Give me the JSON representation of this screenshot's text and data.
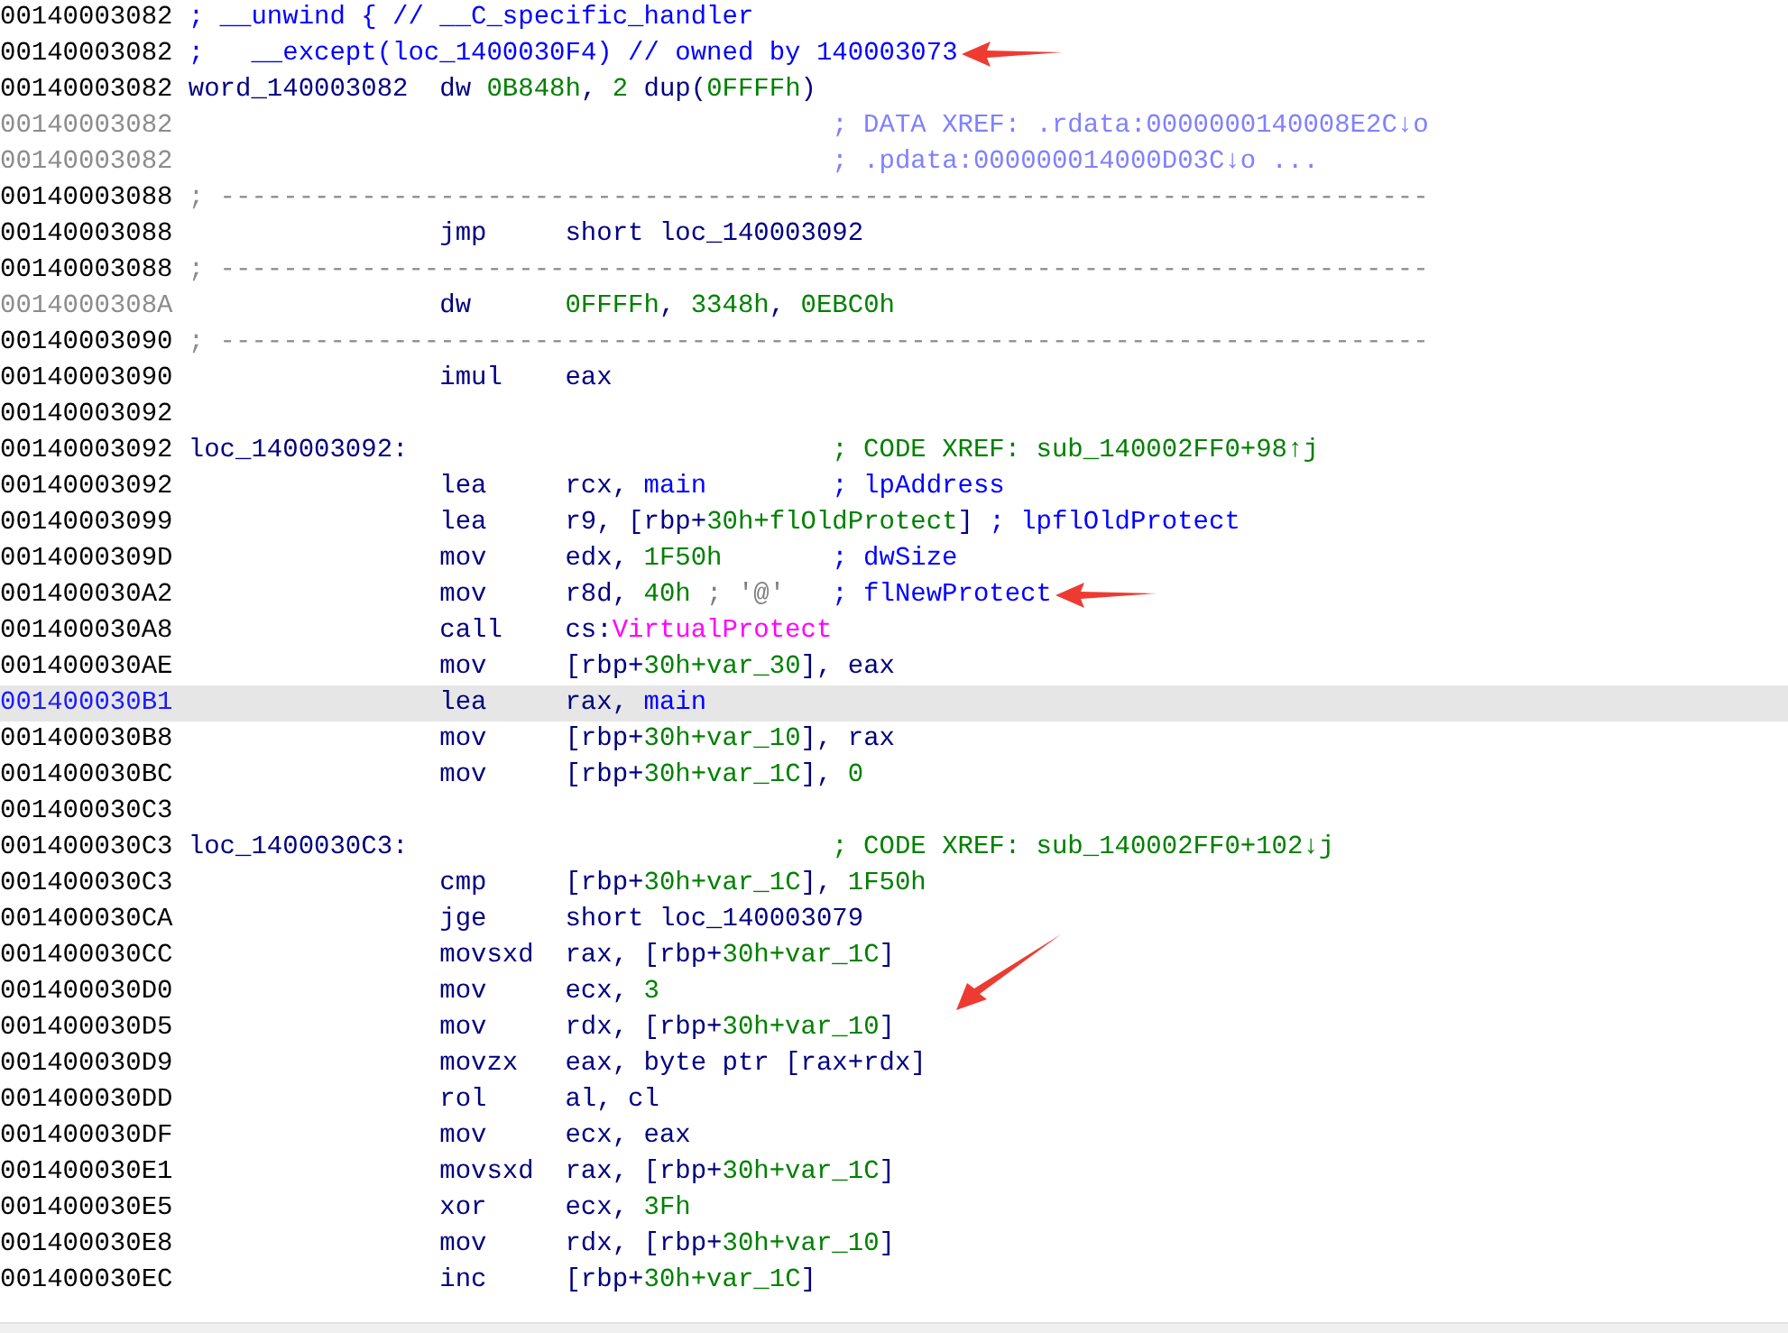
{
  "listing": [
    {
      "address": "00140003082",
      "dim": false,
      "selected": false,
      "kind": "note",
      "text": "; __unwind { // __C_specific_handler"
    },
    {
      "address": "00140003082",
      "dim": false,
      "selected": false,
      "kind": "note",
      "text": ";   __except(loc_1400030F4) // owned by 140003073",
      "arrow": {
        "kind": "left"
      }
    },
    {
      "address": "00140003082",
      "dim": false,
      "selected": false,
      "kind": "data",
      "label": "word_140003082",
      "ops": [
        {
          "t": "dw ",
          "kind": "reg"
        },
        {
          "t": "0B848h",
          "kind": "num"
        },
        {
          "t": ", ",
          "kind": "reg"
        },
        {
          "t": "2",
          "kind": "num"
        },
        {
          "t": " dup(",
          "kind": "reg"
        },
        {
          "t": "0FFFFh",
          "kind": "num"
        },
        {
          "t": ")",
          "kind": "reg"
        }
      ]
    },
    {
      "address": "00140003082",
      "dim": true,
      "selected": false,
      "kind": "xref",
      "comment": "; DATA XREF: .rdata:0000000140008E2C↓o"
    },
    {
      "address": "00140003082",
      "dim": true,
      "selected": false,
      "kind": "xref",
      "comment": "; .pdata:000000014000D03C↓o ..."
    },
    {
      "address": "00140003088",
      "dim": false,
      "selected": false,
      "kind": "sep",
      "text": "; -----------------------------------------------------------------------------"
    },
    {
      "address": "00140003088",
      "dim": false,
      "selected": false,
      "kind": "code",
      "mnemonic": "jmp",
      "ops": [
        {
          "t": "short loc_140003092",
          "kind": "reg"
        }
      ]
    },
    {
      "address": "00140003088",
      "dim": false,
      "selected": false,
      "kind": "sep",
      "text": "; -----------------------------------------------------------------------------"
    },
    {
      "address": "0014000308A",
      "dim": true,
      "selected": false,
      "kind": "code",
      "mnemonic": "dw",
      "ops": [
        {
          "t": "0FFFFh",
          "kind": "num"
        },
        {
          "t": ", ",
          "kind": "reg"
        },
        {
          "t": "3348h",
          "kind": "num"
        },
        {
          "t": ", ",
          "kind": "reg"
        },
        {
          "t": "0EBC0h",
          "kind": "num"
        }
      ]
    },
    {
      "address": "00140003090",
      "dim": false,
      "selected": false,
      "kind": "sep",
      "text": "; -----------------------------------------------------------------------------"
    },
    {
      "address": "00140003090",
      "dim": false,
      "selected": false,
      "kind": "code",
      "mnemonic": "imul",
      "ops": [
        {
          "t": "eax",
          "kind": "reg"
        }
      ]
    },
    {
      "address": "00140003092",
      "dim": false,
      "selected": false,
      "kind": "blank"
    },
    {
      "address": "00140003092",
      "dim": false,
      "selected": false,
      "kind": "label",
      "label": "loc_140003092:",
      "comment": "; CODE XREF: sub_140002FF0+98↑j"
    },
    {
      "address": "00140003092",
      "dim": false,
      "selected": false,
      "kind": "code",
      "mnemonic": "lea",
      "ops": [
        {
          "t": "rcx, ",
          "kind": "reg"
        },
        {
          "t": "main",
          "kind": "name"
        }
      ],
      "comment": "; lpAddress"
    },
    {
      "address": "00140003099",
      "dim": false,
      "selected": false,
      "kind": "code",
      "mnemonic": "lea",
      "ops": [
        {
          "t": "r9, [rbp+",
          "kind": "reg"
        },
        {
          "t": "30h+flOldProtect",
          "kind": "num"
        },
        {
          "t": "]",
          "kind": "reg"
        }
      ],
      "comment": "; lpflOldProtect"
    },
    {
      "address": "0014000309D",
      "dim": false,
      "selected": false,
      "kind": "code",
      "mnemonic": "mov",
      "ops": [
        {
          "t": "edx, ",
          "kind": "reg"
        },
        {
          "t": "1F50h",
          "kind": "num"
        }
      ],
      "comment": "; dwSize"
    },
    {
      "address": "001400030A2",
      "dim": false,
      "selected": false,
      "kind": "code",
      "mnemonic": "mov",
      "ops": [
        {
          "t": "r8d, ",
          "kind": "reg"
        },
        {
          "t": "40h",
          "kind": "num"
        },
        {
          "t": " ; '@'",
          "kind": "cmt"
        }
      ],
      "comment": "; flNewProtect",
      "arrow": {
        "kind": "left"
      }
    },
    {
      "address": "001400030A8",
      "dim": false,
      "selected": false,
      "kind": "code",
      "mnemonic": "call",
      "ops": [
        {
          "t": "cs:",
          "kind": "reg"
        },
        {
          "t": "VirtualProtect",
          "kind": "import"
        }
      ]
    },
    {
      "address": "001400030AE",
      "dim": false,
      "selected": false,
      "kind": "code",
      "mnemonic": "mov",
      "ops": [
        {
          "t": "[rbp+",
          "kind": "reg"
        },
        {
          "t": "30h+var_30",
          "kind": "num"
        },
        {
          "t": "], eax",
          "kind": "reg"
        }
      ]
    },
    {
      "address": "001400030B1",
      "dim": false,
      "selected": true,
      "kind": "code",
      "mnemonic": "lea",
      "ops": [
        {
          "t": "rax, ",
          "kind": "reg"
        },
        {
          "t": "main",
          "kind": "name"
        }
      ]
    },
    {
      "address": "001400030B8",
      "dim": false,
      "selected": false,
      "kind": "code",
      "mnemonic": "mov",
      "ops": [
        {
          "t": "[rbp+",
          "kind": "reg"
        },
        {
          "t": "30h+var_10",
          "kind": "num"
        },
        {
          "t": "], rax",
          "kind": "reg"
        }
      ]
    },
    {
      "address": "001400030BC",
      "dim": false,
      "selected": false,
      "kind": "code",
      "mnemonic": "mov",
      "ops": [
        {
          "t": "[rbp+",
          "kind": "reg"
        },
        {
          "t": "30h+var_1C",
          "kind": "num"
        },
        {
          "t": "], ",
          "kind": "reg"
        },
        {
          "t": "0",
          "kind": "num"
        }
      ]
    },
    {
      "address": "001400030C3",
      "dim": false,
      "selected": false,
      "kind": "blank"
    },
    {
      "address": "001400030C3",
      "dim": false,
      "selected": false,
      "kind": "label",
      "label": "loc_1400030C3:",
      "comment": "; CODE XREF: sub_140002FF0+102↓j"
    },
    {
      "address": "001400030C3",
      "dim": false,
      "selected": false,
      "kind": "code",
      "mnemonic": "cmp",
      "ops": [
        {
          "t": "[rbp+",
          "kind": "reg"
        },
        {
          "t": "30h+var_1C",
          "kind": "num"
        },
        {
          "t": "], ",
          "kind": "reg"
        },
        {
          "t": "1F50h",
          "kind": "num"
        }
      ]
    },
    {
      "address": "001400030CA",
      "dim": false,
      "selected": false,
      "kind": "code",
      "mnemonic": "jge",
      "ops": [
        {
          "t": "short loc_140003079",
          "kind": "reg"
        }
      ]
    },
    {
      "address": "001400030CC",
      "dim": false,
      "selected": false,
      "kind": "code",
      "mnemonic": "movsxd",
      "ops": [
        {
          "t": "rax, [rbp+",
          "kind": "reg"
        },
        {
          "t": "30h+var_1C",
          "kind": "num"
        },
        {
          "t": "]",
          "kind": "reg"
        }
      ]
    },
    {
      "address": "001400030D0",
      "dim": false,
      "selected": false,
      "kind": "code",
      "mnemonic": "mov",
      "ops": [
        {
          "t": "ecx, ",
          "kind": "reg"
        },
        {
          "t": "3",
          "kind": "num"
        }
      ],
      "arrow": {
        "kind": "diagonal"
      }
    },
    {
      "address": "001400030D5",
      "dim": false,
      "selected": false,
      "kind": "code",
      "mnemonic": "mov",
      "ops": [
        {
          "t": "rdx, [rbp+",
          "kind": "reg"
        },
        {
          "t": "30h+var_10",
          "kind": "num"
        },
        {
          "t": "]",
          "kind": "reg"
        }
      ]
    },
    {
      "address": "001400030D9",
      "dim": false,
      "selected": false,
      "kind": "code",
      "mnemonic": "movzx",
      "ops": [
        {
          "t": "eax, byte ptr [rax+rdx]",
          "kind": "reg"
        }
      ]
    },
    {
      "address": "001400030DD",
      "dim": false,
      "selected": false,
      "kind": "code",
      "mnemonic": "rol",
      "ops": [
        {
          "t": "al, cl",
          "kind": "reg"
        }
      ]
    },
    {
      "address": "001400030DF",
      "dim": false,
      "selected": false,
      "kind": "code",
      "mnemonic": "mov",
      "ops": [
        {
          "t": "ecx, eax",
          "kind": "reg"
        }
      ]
    },
    {
      "address": "001400030E1",
      "dim": false,
      "selected": false,
      "kind": "code",
      "mnemonic": "movsxd",
      "ops": [
        {
          "t": "rax, [rbp+",
          "kind": "reg"
        },
        {
          "t": "30h+var_1C",
          "kind": "num"
        },
        {
          "t": "]",
          "kind": "reg"
        }
      ]
    },
    {
      "address": "001400030E5",
      "dim": false,
      "selected": false,
      "kind": "code",
      "mnemonic": "xor",
      "ops": [
        {
          "t": "ecx, ",
          "kind": "reg"
        },
        {
          "t": "3Fh",
          "kind": "num"
        }
      ]
    },
    {
      "address": "001400030E8",
      "dim": false,
      "selected": false,
      "kind": "code",
      "mnemonic": "mov",
      "ops": [
        {
          "t": "rdx, [rbp+",
          "kind": "reg"
        },
        {
          "t": "30h+var_10",
          "kind": "num"
        },
        {
          "t": "]",
          "kind": "reg"
        }
      ]
    },
    {
      "address": "001400030EC",
      "dim": false,
      "selected": false,
      "kind": "code",
      "mnemonic": "inc",
      "ops": [
        {
          "t": "[rbp+",
          "kind": "reg"
        },
        {
          "t": "30h+var_1C",
          "kind": "num"
        },
        {
          "t": "]",
          "kind": "reg"
        }
      ]
    }
  ]
}
